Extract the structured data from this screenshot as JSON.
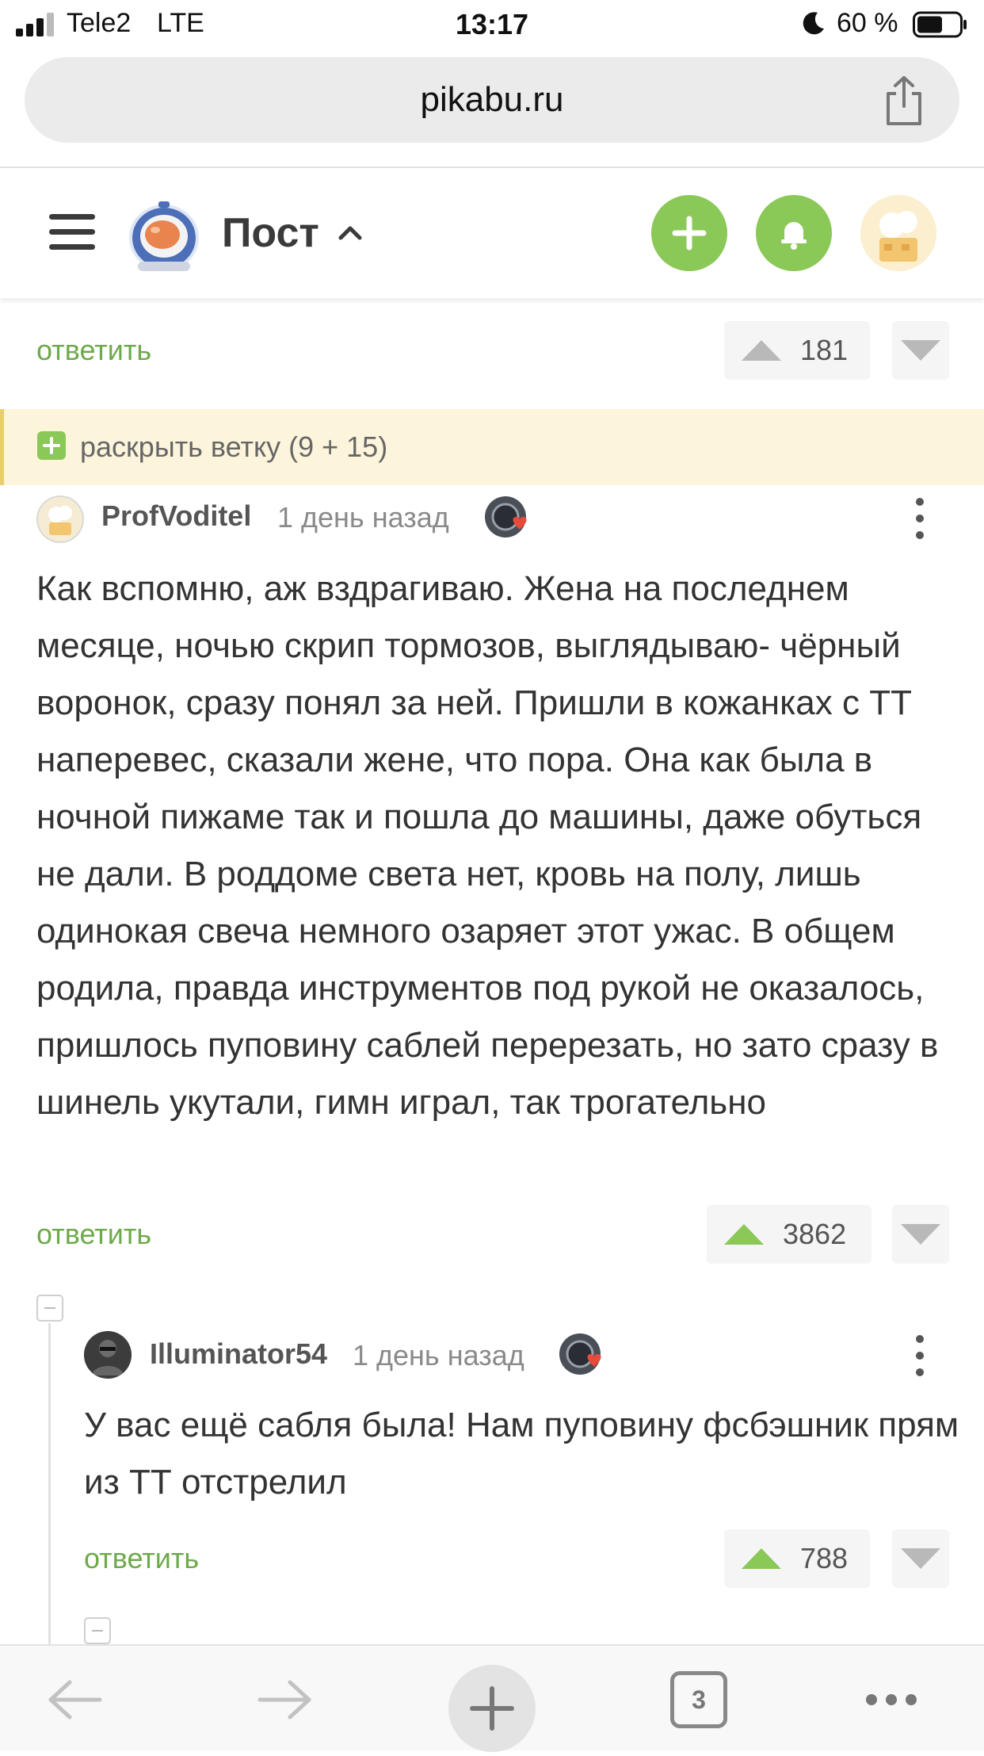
{
  "status_bar": {
    "carrier": "Tele2",
    "network": "LTE",
    "time": "13:17",
    "battery_percent": "60 %",
    "battery_level": 0.6
  },
  "browser": {
    "url": "pikabu.ru"
  },
  "header": {
    "title": "Пост"
  },
  "top_reply": {
    "reply_label": "ответить",
    "votes": "181"
  },
  "expand_branch": {
    "label": "раскрыть ветку (9 + 15)"
  },
  "comments": [
    {
      "username": "ProfVoditel",
      "timestamp": "1 день назад",
      "text": "Как вспомню, аж вздрагиваю. Жена на последнем месяце, ночью скрип тормозов, выглядываю- чёрный воронок, сразу понял за ней. Пришли в кожанках с ТТ наперевес, сказали жене, что пора. Она как была в ночной пижаме так и пошла до машины, даже обуться не дали. В роддоме света нет, кровь на полу, лишь одинокая свеча немного озаряет этот ужас. В общем родила, правда инструментов под рукой не оказалось, пришлось пуповину саблей перерезать, но зато сразу в шинель укутали, гимн играл, так трогательно",
      "reply_label": "ответить",
      "votes": "3862"
    },
    {
      "username": "Illuminator54",
      "timestamp": "1 день назад",
      "text": "У вас ещё сабля была! Нам пуповину фсбэшник прям из ТТ отстрелил",
      "reply_label": "ответить",
      "votes": "788"
    }
  ],
  "bottom_bar": {
    "tabs_count": "3"
  },
  "colors": {
    "accent_green": "#8ac858",
    "link_green": "#6ea94a",
    "expand_bg": "#fcf5dc"
  }
}
